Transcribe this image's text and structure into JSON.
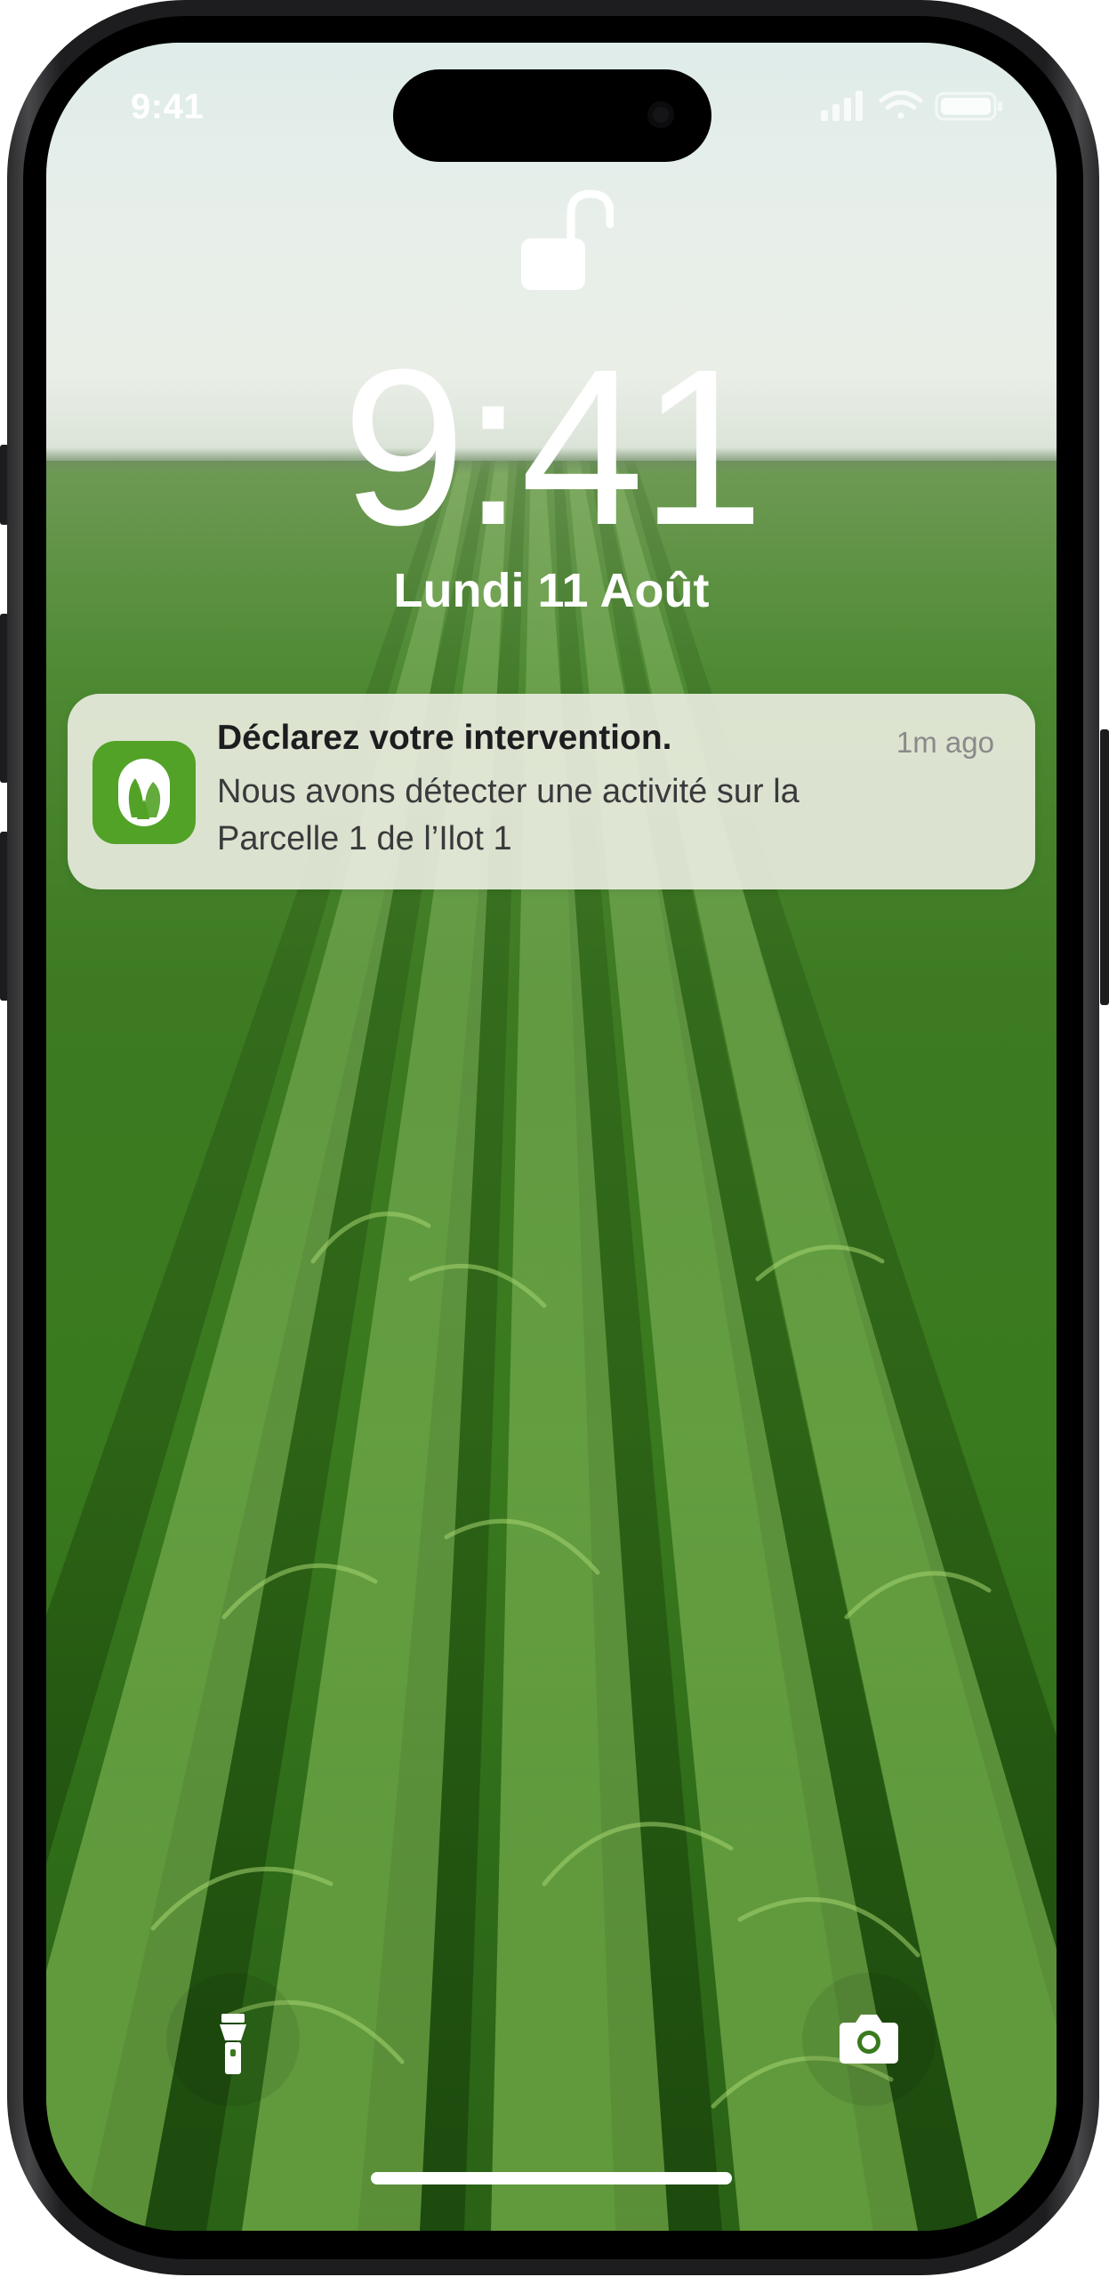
{
  "status_bar": {
    "time": "9:41",
    "signal_icon": "cellular-signal-icon",
    "wifi_icon": "wifi-icon",
    "battery_icon": "battery-icon"
  },
  "lock_screen": {
    "lock_icon": "unlocked-padlock-icon",
    "time": "9:41",
    "date": "Lundi 11 Août"
  },
  "notification": {
    "app_icon": "leaf-icon",
    "title": "Déclarez votre intervention.",
    "time_ago": "1m ago",
    "body_lines": [
      "Nous avons détecter une activité sur la",
      "Parcelle 1 de l’Ilot 1"
    ]
  },
  "bottom_controls": {
    "flashlight_icon": "flashlight-icon",
    "camera_icon": "camera-icon"
  },
  "colors": {
    "app_icon_bg": "#52a227",
    "notification_bg": "#e8ecde"
  }
}
